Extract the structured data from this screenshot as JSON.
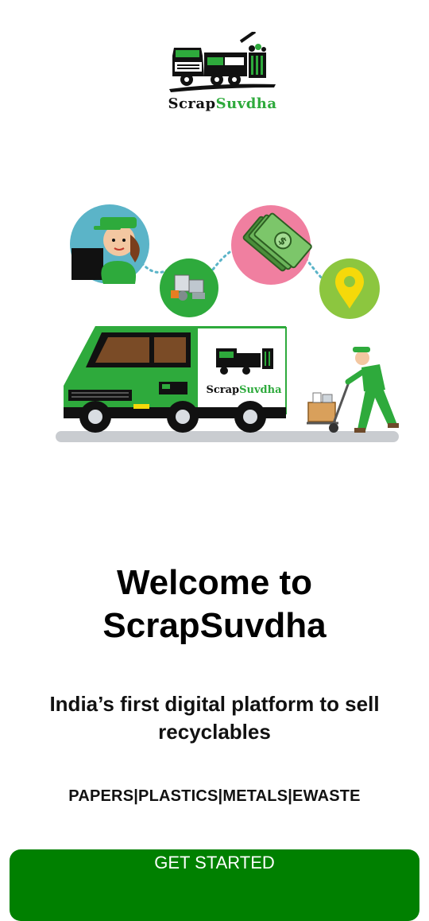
{
  "brand": {
    "logo_part1": "Scrap",
    "logo_part2": "Suvdha",
    "truck_label_part1": "Scrap",
    "truck_label_part2": "Suvdha"
  },
  "welcome": {
    "line1": "Welcome to",
    "line2": "ScrapSuvdha"
  },
  "tagline": {
    "line1": "India’s first digital platform to sell",
    "line2": "recyclables"
  },
  "categories": "PAPERS|PLASTICS|METALS|EWASTE",
  "cta_label": "GET STARTED",
  "colors": {
    "brand_green": "#2eaa3c",
    "button_green": "#008000",
    "bubble_blue": "#5bb4c8",
    "bubble_pink": "#f07fa0",
    "bubble_lime": "#8cc63f",
    "road_gray": "#c9ccd0"
  },
  "icons": [
    "garbage-truck-icon",
    "agent-avatar-icon",
    "scrap-pile-icon",
    "money-icon",
    "location-pin-icon",
    "delivery-van-icon",
    "worker-with-trolley-icon"
  ]
}
